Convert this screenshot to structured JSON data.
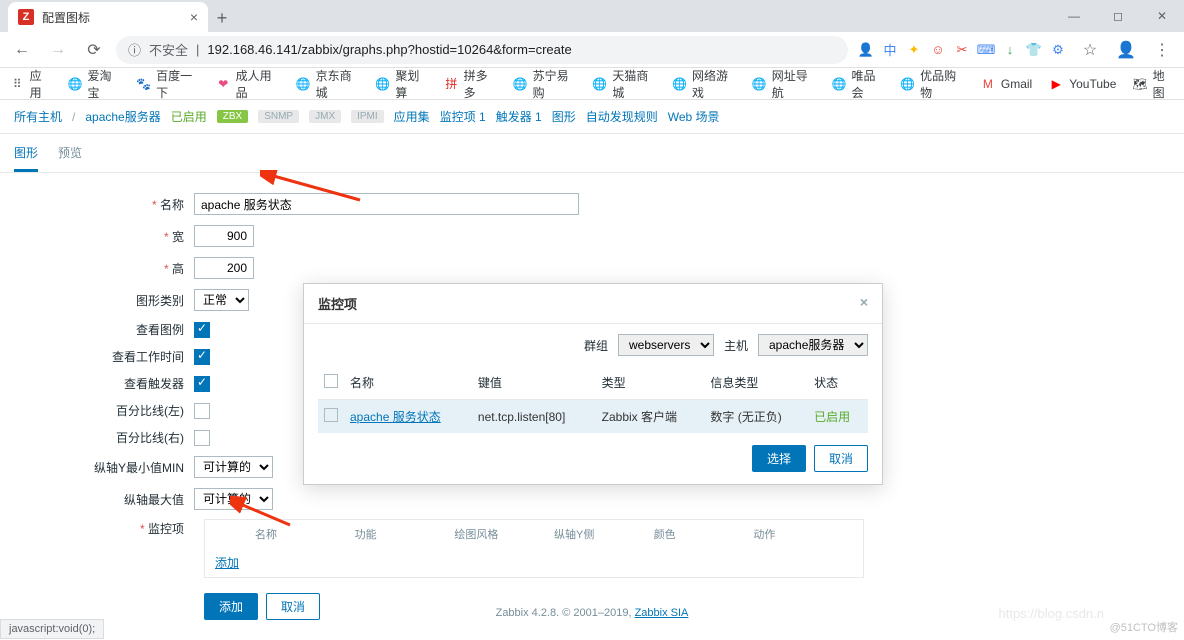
{
  "browser": {
    "tab_title": "配置图标",
    "favicon_letter": "Z",
    "url_prefix": "不安全",
    "url": "192.168.46.141/zabbix/graphs.php?hostid=10264&form=create",
    "apps_label": "应用",
    "bookmarks": [
      "爱淘宝",
      "百度一下",
      "成人用品",
      "京东商城",
      "聚划算",
      "拼多多",
      "苏宁易购",
      "天猫商城",
      "网络游戏",
      "网址导航",
      "唯品会",
      "优品购物",
      "Gmail",
      "YouTube",
      "地图"
    ]
  },
  "breadcrumb": {
    "all_hosts": "所有主机",
    "host": "apache服务器",
    "enabled": "已启用",
    "zbx": "ZBX",
    "snmp": "SNMP",
    "jmx": "JMX",
    "ipmi": "IPMI",
    "app_sets": "应用集",
    "items": "监控项 1",
    "triggers": "触发器 1",
    "graphs": "图形",
    "discovery": "自动发现规则",
    "web": "Web 场景"
  },
  "tabs": {
    "graph": "图形",
    "preview": "预览"
  },
  "form": {
    "name_label": "名称",
    "name_value": "apache 服务状态",
    "width_label": "宽",
    "width_value": "900",
    "height_label": "高",
    "height_value": "200",
    "type_label": "图形类别",
    "type_value": "正常",
    "legend_label": "查看图例",
    "worktime_label": "查看工作时间",
    "triggers_label": "查看触发器",
    "percent_left_label": "百分比线(左)",
    "percent_right_label": "百分比线(右)",
    "ymin_label": "纵轴Y最小值MIN",
    "ymin_value": "可计算的",
    "ymax_label": "纵轴最大值",
    "ymax_value": "可计算的",
    "items_label": "监控项",
    "col_name": "名称",
    "col_func": "功能",
    "col_draw": "绘图风格",
    "col_yaxis": "纵轴Y侧",
    "col_color": "颜色",
    "col_action": "动作",
    "add_link": "添加",
    "btn_add": "添加",
    "btn_cancel": "取消"
  },
  "modal": {
    "title": "监控项",
    "group_label": "群组",
    "group_value": "webservers",
    "host_label": "主机",
    "host_value": "apache服务器",
    "col_name": "名称",
    "col_key": "键值",
    "col_type": "类型",
    "col_info": "信息类型",
    "col_status": "状态",
    "row_name": "apache 服务状态",
    "row_key": "net.tcp.listen[80]",
    "row_type": "Zabbix 客户端",
    "row_info": "数字 (无正负)",
    "row_status": "已启用",
    "btn_select": "选择",
    "btn_cancel": "取消"
  },
  "footer": {
    "text": "Zabbix 4.2.8. © 2001–2019, ",
    "link": "Zabbix SIA"
  },
  "statusbar": "javascript:void(0);",
  "watermark": "@51CTO博客",
  "watermark2": "https://blog.csdn.n"
}
